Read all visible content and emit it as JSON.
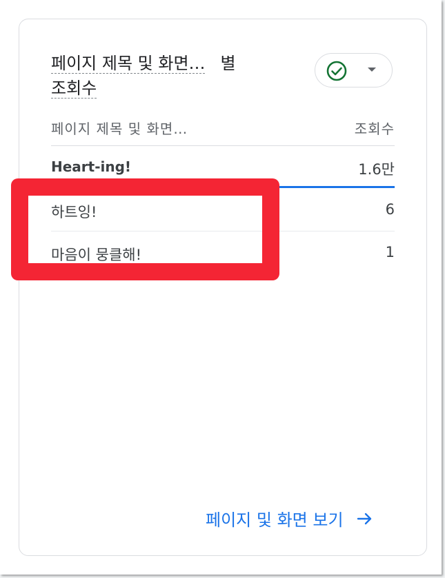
{
  "card": {
    "title_part1": "페이지 제목 및 화면…",
    "title_part2": "별",
    "title_part3": "조회수",
    "compare_icon": "check-circle-icon",
    "dropdown_icon": "caret-down-icon",
    "accent_color": "#1a73e8",
    "check_color": "#137333"
  },
  "table": {
    "headers": {
      "dimension": "페이지 제목 및 화면…",
      "metric": "조회수"
    },
    "rows": [
      {
        "label": "Heart-ing!",
        "value": "1.6만",
        "share": 1.0
      },
      {
        "label": "하트잉!",
        "value": "6",
        "share": 0
      },
      {
        "label": "마음이 뭉클해!",
        "value": "1",
        "share": 0
      }
    ]
  },
  "footer": {
    "view_link": "페이지 및 화면 보기",
    "arrow_icon": "arrow-right-icon"
  },
  "annotation": {
    "color": "#f42534"
  }
}
